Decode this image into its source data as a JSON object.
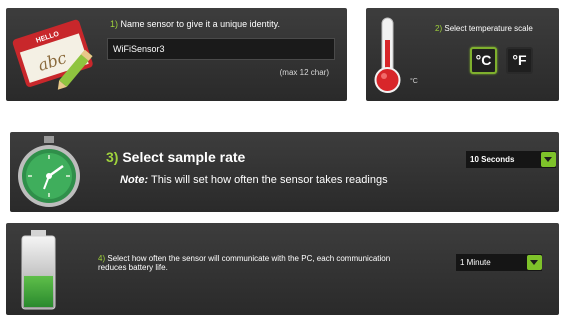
{
  "name_panel": {
    "step": "1)",
    "title": "Name sensor to give it a unique identity.",
    "value": "WiFiSensor3",
    "hint": "(max 12 char)",
    "tag_hello": "HELLO",
    "tag_name": "abc"
  },
  "temp_panel": {
    "step": "2)",
    "title": "Select temperature scale",
    "small_unit": "°C",
    "celsius_label": "°C",
    "fahrenheit_label": "°F",
    "selected": "°C"
  },
  "sample_panel": {
    "step": "3)",
    "title": "Select sample rate",
    "note_label": "Note:",
    "note_text": "This will set how often the sensor takes readings",
    "selected_value": "10 Seconds"
  },
  "comm_panel": {
    "step": "4)",
    "title": "Select how often the sensor will communicate with the PC, each communication reduces battery life.",
    "selected_value": "1 Minute",
    "battery_level": 0.45
  },
  "colors": {
    "accent": "#9fd23c",
    "button_green": "#7ec22a",
    "panel_bg": "#333333",
    "thermo_red": "#d8262a",
    "battery_green": "#3f9f35",
    "watch_green": "#2f8f4a"
  }
}
